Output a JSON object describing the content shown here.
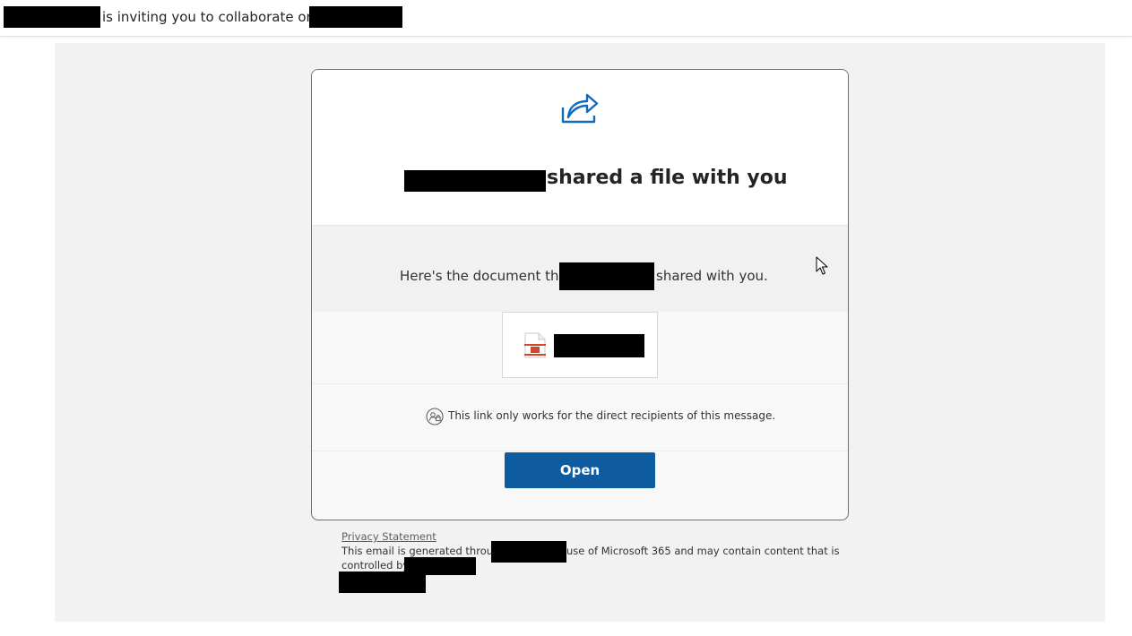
{
  "subject": {
    "text": "is inviting you to collaborate on"
  },
  "card": {
    "title_suffix": "shared a file with you",
    "message_prefix": "Here's the document that",
    "message_suffix": "shared with you.",
    "notice": "This link only works for the direct recipients of this message.",
    "open_label": "Open"
  },
  "footer": {
    "privacy_label": "Privacy Statement",
    "line1_prefix": "This email is generated through",
    "line1_suffix": "use of Microsoft 365 and may contain content that is",
    "line2_prefix": "controlled by"
  },
  "icons": {
    "share": "share-icon",
    "file": "presentation-file-icon",
    "recipients": "people-lock-icon",
    "cursor": "mouse-cursor-icon"
  },
  "colors": {
    "accent": "#0f5ba0",
    "share_icon": "#0f6cbd",
    "file_icon_red": "#d24726",
    "canvas_bg": "#f2f2f2"
  }
}
